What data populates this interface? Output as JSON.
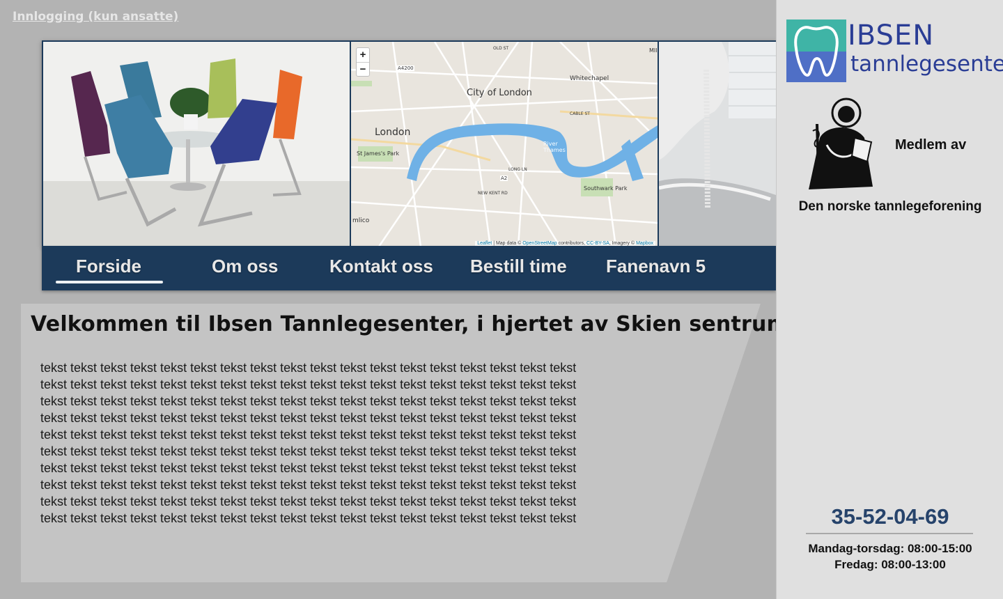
{
  "header": {
    "login_link": "Innlogging (kun ansatte)"
  },
  "map": {
    "zoom_in": "+",
    "zoom_out": "−",
    "labels": {
      "city_of_london": "City of London",
      "london": "London",
      "st_james_park": "St James's Park",
      "whitechapel": "Whitechapel",
      "river_thames": "River Thames",
      "southwark_park": "Southwark Park",
      "a4200": "A4200",
      "a2": "A2",
      "cable_st": "CABLE ST",
      "new_kent_rd": "NEW KENT RD",
      "long_ln": "LONG LN",
      "old_st": "OLD ST",
      "mile": "MIl",
      "mlico": "mlico"
    },
    "attribution": {
      "leaflet": "Leaflet",
      "sep": " | Map data © ",
      "osm": "OpenStreetMap",
      "contrib": " contributors, ",
      "license": "CC-BY-SA",
      "imagery": ", Imagery © ",
      "mapbox": "Mapbox"
    }
  },
  "nav": {
    "items": [
      {
        "label": "Forside",
        "active": true
      },
      {
        "label": "Om oss"
      },
      {
        "label": "Kontakt oss"
      },
      {
        "label": "Bestill time"
      },
      {
        "label": "Fanenavn 5"
      }
    ]
  },
  "main": {
    "headline": "Velkommen til Ibsen Tannlegesenter, i hjertet av Skien sentrum",
    "body_lines": [
      "tekst tekst tekst tekst tekst tekst tekst tekst tekst tekst tekst tekst tekst tekst tekst tekst tekst tekst",
      "tekst tekst tekst tekst tekst tekst tekst tekst tekst tekst tekst tekst tekst tekst tekst tekst tekst tekst",
      "tekst tekst tekst tekst tekst tekst tekst tekst tekst tekst tekst tekst tekst tekst tekst tekst tekst tekst",
      "tekst tekst tekst tekst tekst tekst tekst tekst tekst tekst tekst tekst tekst tekst tekst tekst tekst tekst",
      "tekst tekst tekst tekst tekst tekst tekst tekst tekst tekst tekst tekst tekst tekst tekst tekst tekst tekst",
      "tekst tekst tekst tekst tekst tekst tekst tekst tekst tekst tekst tekst tekst tekst tekst tekst tekst tekst",
      "tekst tekst tekst tekst tekst tekst tekst tekst tekst tekst tekst tekst tekst tekst tekst tekst tekst tekst",
      "tekst tekst tekst tekst tekst tekst tekst tekst tekst tekst tekst tekst tekst tekst tekst tekst tekst tekst",
      "tekst tekst tekst tekst tekst tekst tekst tekst tekst tekst tekst tekst tekst tekst tekst tekst tekst tekst",
      "tekst tekst tekst tekst tekst tekst tekst tekst tekst tekst tekst tekst tekst tekst tekst tekst tekst tekst"
    ]
  },
  "sidebar": {
    "logo": {
      "line1": "IBSEN",
      "line2": "tannlegesenter"
    },
    "member_label": "Medlem av",
    "member_org": "Den norske tannlegeforening",
    "phone": "35-52-04-69",
    "hours": [
      "Mandag-torsdag: 08:00-15:00",
      "Fredag: 08:00-13:00"
    ]
  },
  "colors": {
    "page_bg": "#b3b3b3",
    "nav_bg": "#1c3a5a",
    "sidebar_bg": "#e0e0e0",
    "phone": "#26436b",
    "logo_blue": "#2a3d95",
    "logo_teal": "#3fb4a6",
    "river": "#6fb1e6"
  }
}
